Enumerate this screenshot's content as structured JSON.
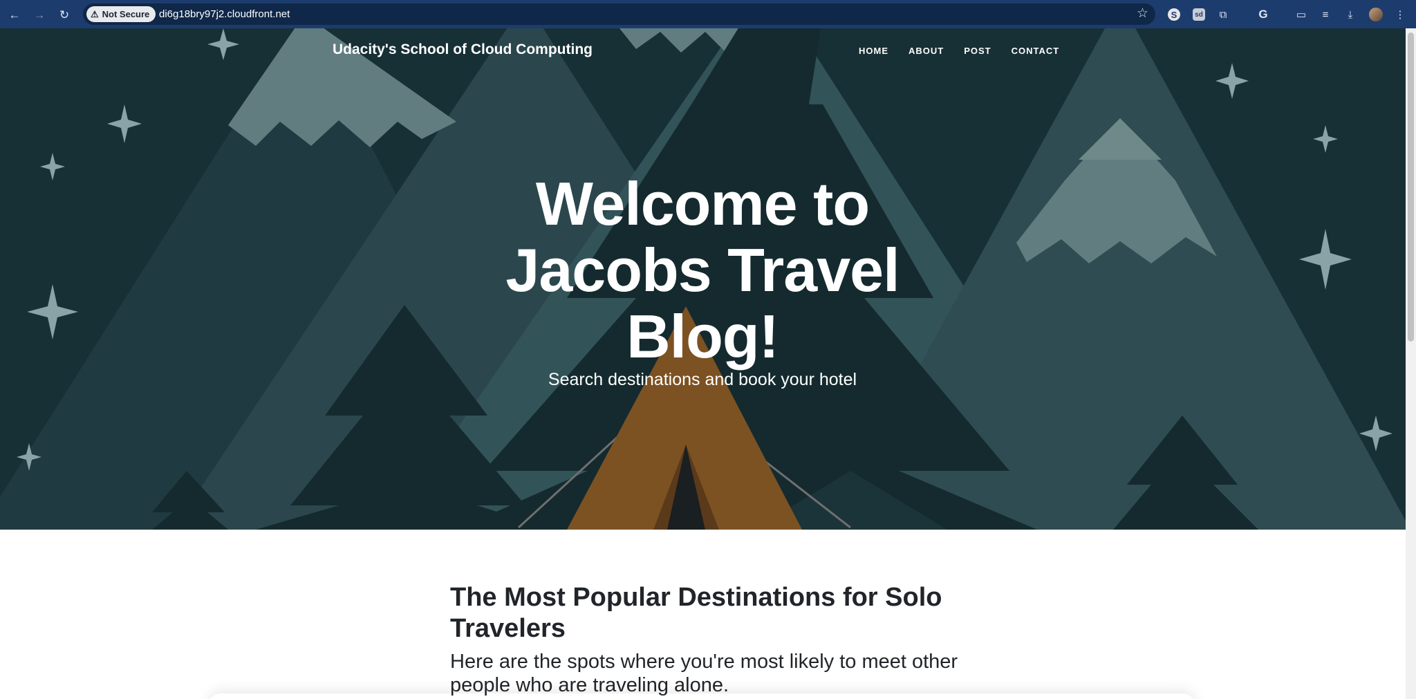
{
  "browser": {
    "security_label": "Not Secure",
    "url": "di6g18bry97j2.cloudfront.net",
    "extension_s_label": "S",
    "extension_sd_label": "sd",
    "extension_g_label": "G"
  },
  "site": {
    "brand": "Udacity's School of Cloud Computing",
    "nav": [
      "HOME",
      "ABOUT",
      "POST",
      "CONTACT"
    ]
  },
  "hero": {
    "title": "Welcome to Jacobs Travel Blog!",
    "subtitle": "Search destinations and book your hotel"
  },
  "post": {
    "title": "The Most Popular Destinations for Solo Travelers",
    "subtitle": "Here are the spots where you're most likely to meet other people who are traveling alone."
  },
  "colors": {
    "chrome": "#1d3c6e",
    "sky": "#173036",
    "tent": "#7c5223"
  }
}
